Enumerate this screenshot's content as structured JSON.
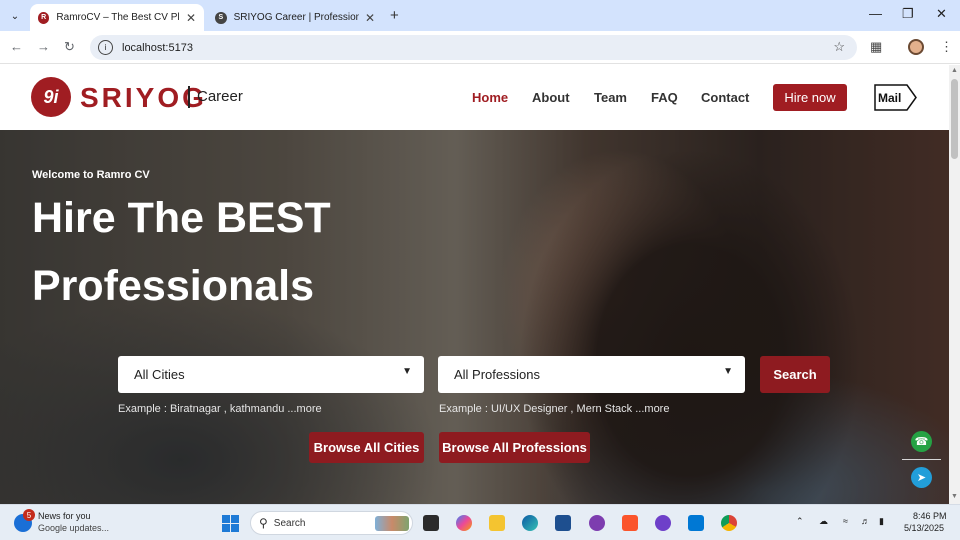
{
  "browser": {
    "tabs": [
      {
        "title": "RamroCV – The Best CV Platform",
        "favicon_letter": "R",
        "favicon_color": "#a01d22"
      },
      {
        "title": "SRIYOG Career | Professional M",
        "favicon_letter": "S",
        "favicon_color": "#444444"
      }
    ],
    "url": "localhost:5173"
  },
  "site": {
    "logo_text": "SRIYOG",
    "logo_glyph": "9i",
    "logo_sub": "Career",
    "brand_color": "#a01d22",
    "nav": [
      "Home",
      "About",
      "Team",
      "FAQ",
      "Contact"
    ],
    "hire_label": "Hire now",
    "mail_label": "Mail"
  },
  "hero": {
    "welcome": "Welcome to Ramro CV",
    "title_line1": "Hire The BEST",
    "title_line2": "Professionals",
    "city_select": "All Cities",
    "profession_select": "All Professions",
    "search_label": "Search",
    "city_example": "Example : Biratnagar , kathmandu ...more",
    "profession_example": "Example : UI/UX Designer , Mern Stack ...more",
    "browse_cities": "Browse All Cities",
    "browse_professions": "Browse All Professions"
  },
  "taskbar": {
    "news_badge": "5",
    "news_title": "News for you",
    "news_sub": "Google updates...",
    "search_placeholder": "Search",
    "time": "8:46 PM",
    "date": "5/13/2025"
  }
}
